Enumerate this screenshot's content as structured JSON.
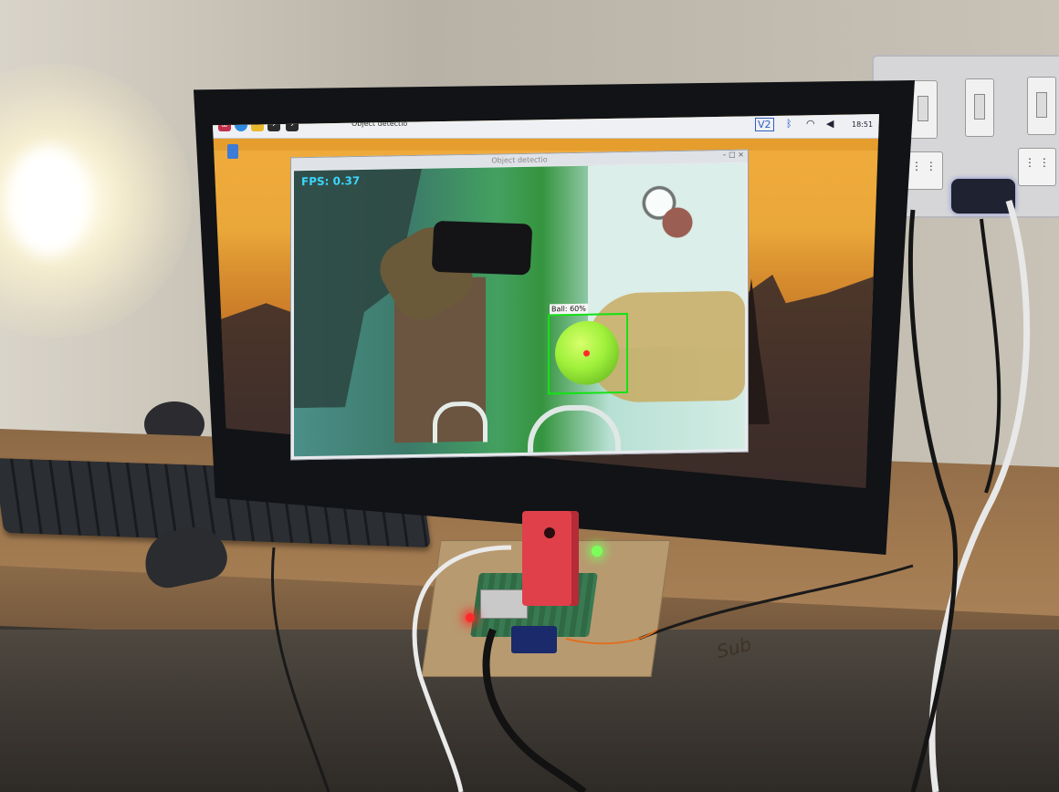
{
  "taskbar": {
    "tasks": [
      "Object detectio"
    ],
    "clock": "18:51",
    "tray_badge": "V2",
    "icons": [
      "raspberry-pi-menu-icon",
      "browser-icon",
      "file-manager-icon",
      "terminal-icon",
      "bluetooth-icon",
      "wifi-icon",
      "volume-icon"
    ]
  },
  "app_window": {
    "title": "Object detectio",
    "fps_label": "FPS: 0.37",
    "detection_label": "Ball: 60%",
    "box_color": "#14e214",
    "fps_color": "#3bd6ff"
  },
  "desk": {
    "scribble": "Sub"
  }
}
